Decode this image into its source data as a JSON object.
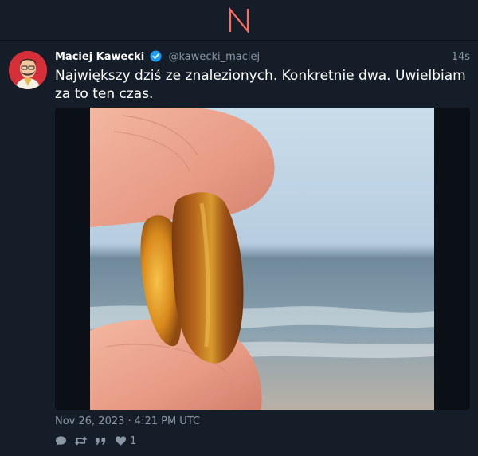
{
  "app": {
    "logo_icon": "nitter-n-logo-icon",
    "accent_color": "#ff6c60"
  },
  "tweet": {
    "author_name": "Maciej Kawecki",
    "verified_icon": "verified-badge-icon",
    "handle": "@kawecki_maciej",
    "time_ago": "14s",
    "text": "Największy dziś ze znalezionych. Konkretnie dwa. Uwielbiam za to ten czas.",
    "media_description_icon": "photo-amber-on-beach",
    "date": "Nov 26, 2023 · 4:21 PM UTC",
    "stats": {
      "reply_icon": "comment-icon",
      "retweet_icon": "retweet-icon",
      "quote_icon": "quote-icon",
      "like_icon": "heart-icon",
      "likes": "1"
    }
  }
}
